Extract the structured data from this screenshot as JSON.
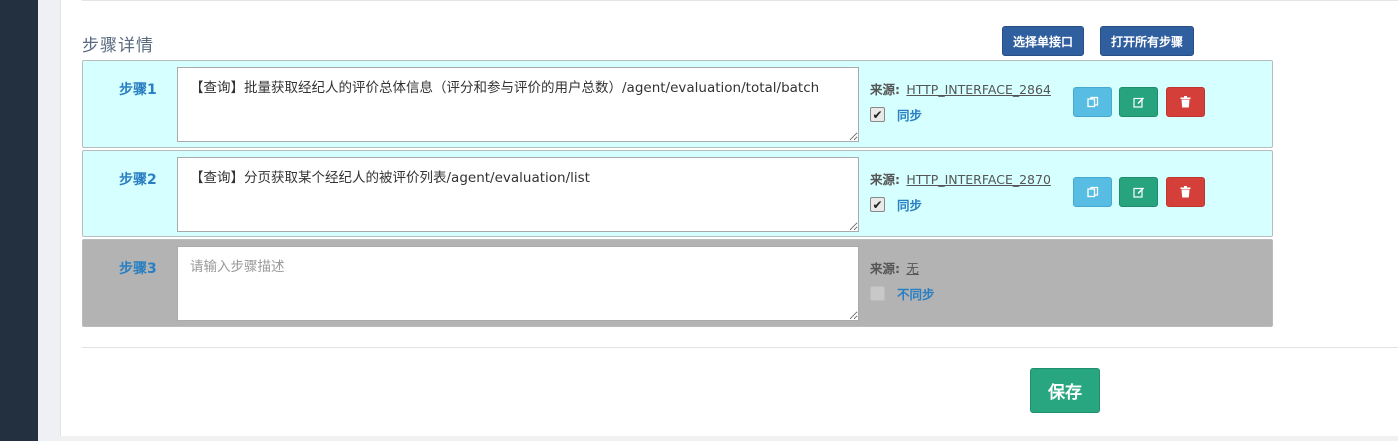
{
  "section": {
    "title": "步骤详情",
    "select_button": "选择单接口",
    "open_all_button": "打开所有步骤"
  },
  "steps": [
    {
      "label": "步骤1",
      "description": "【查询】批量获取经纪人的评价总体信息（评分和参与评价的用户总数）/agent/evaluation/total/batch",
      "placeholder": "",
      "source_label": "来源:",
      "source_value": "HTTP_INTERFACE_2864",
      "sync_checked": true,
      "sync_label": "同步",
      "state": "active"
    },
    {
      "label": "步骤2",
      "description": "【查询】分页获取某个经纪人的被评价列表/agent/evaluation/list",
      "placeholder": "",
      "source_label": "来源:",
      "source_value": "HTTP_INTERFACE_2870",
      "sync_checked": true,
      "sync_label": "同步",
      "state": "active"
    },
    {
      "label": "步骤3",
      "description": "",
      "placeholder": "请输入步骤描述",
      "source_label": "来源:",
      "source_value": "无",
      "sync_checked": false,
      "sync_label": "不同步",
      "state": "inactive"
    }
  ],
  "footer": {
    "save_button": "保存"
  },
  "colors": {
    "active_row": "#d6ffff",
    "inactive_row": "#b3b3b3",
    "primary_button": "#2f5f9e",
    "save_button": "#28a67f",
    "copy_button": "#57bde3",
    "edit_button": "#27a37e",
    "delete_button": "#d43f3a",
    "label_blue": "#2a7fc2"
  },
  "icons": {
    "copy": "copy-icon",
    "edit": "edit-icon",
    "delete": "trash-icon"
  }
}
